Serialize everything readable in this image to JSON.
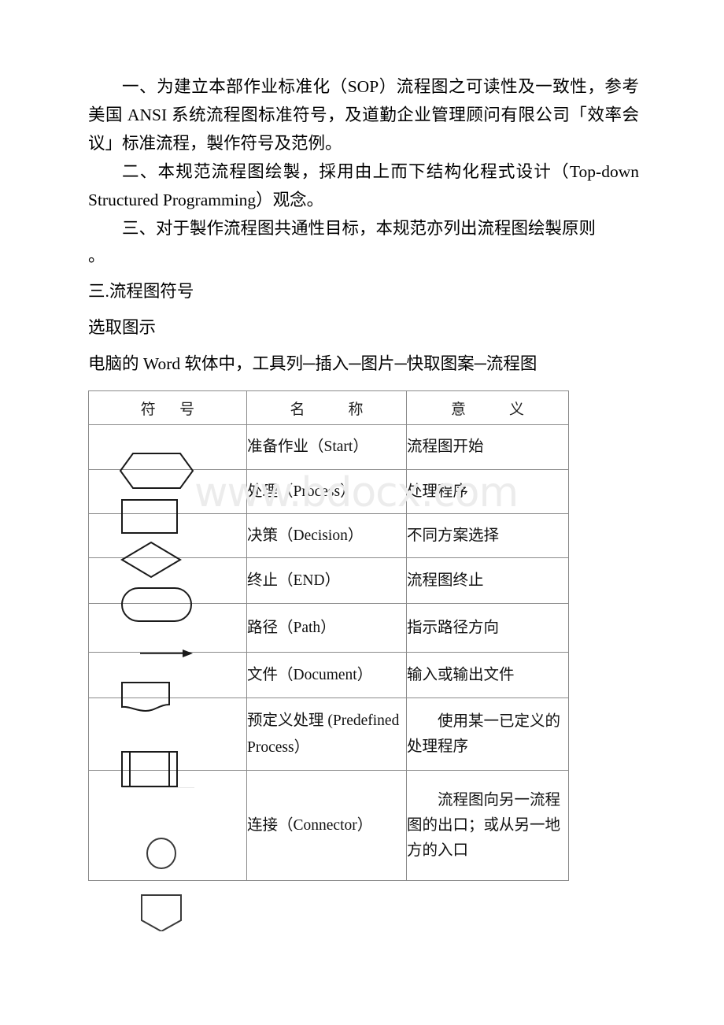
{
  "document": {
    "watermark": "www.bdocx.com",
    "paragraphs": [
      {
        "id": "p1",
        "text": "一、为建立本部作业标准化（SOP）流程图之可读性及一致性，参考美国 ANSI 系统流程图标准符号，及道勤企业管理顾问有限公司「效率会议」标准流程，製作符号及范例。"
      },
      {
        "id": "p2",
        "text": "二、本规范流程图绘製，採用由上而下结构化程式设计（Top-down Structured Programming）观念。"
      },
      {
        "id": "p3",
        "text": "三、对于製作流程图共通性目标，本规范亦列出流程图绘製原则"
      },
      {
        "id": "p3_tail",
        "text": "。"
      }
    ],
    "headings": {
      "section": "三.流程图符号",
      "sub": "选取图示"
    },
    "instruction": "电脑的 Word 软体中，工具列─插入─图片─快取图案─流程图"
  },
  "table": {
    "headers": [
      "符　号",
      "名　　称",
      "意　　义"
    ],
    "rows": [
      {
        "symbol_icon": "hexagon-shape",
        "name": "准备作业（Start）",
        "meaning": "流程图开始",
        "meaning_indent": false
      },
      {
        "symbol_icon": "rectangle-shape",
        "name": "处理（Process）",
        "meaning": "处理程序",
        "meaning_indent": false
      },
      {
        "symbol_icon": "diamond-shape",
        "name": "决策（Decision）",
        "meaning": "不同方案选择",
        "meaning_indent": false
      },
      {
        "symbol_icon": "stadium-shape",
        "name": "终止（END）",
        "meaning": "流程图终止",
        "meaning_indent": false
      },
      {
        "symbol_icon": "arrow-shape",
        "name": "路径（Path）",
        "meaning": "指示路径方向",
        "meaning_indent": false
      },
      {
        "symbol_icon": "document-shape",
        "name": "文件（Document）",
        "meaning": "输入或输出文件",
        "meaning_indent": false
      },
      {
        "symbol_icon": "predefined-process-shape",
        "name": "预定义处理 (Predefined Process）",
        "meaning": "使用某一已定义的处理程序",
        "meaning_indent": true
      },
      {
        "symbol_icon": "connector-shape",
        "name": "连接（Connector）",
        "meaning": "流程图向另一流程图的出口；或从另一地方的入口",
        "meaning_indent": true
      }
    ]
  }
}
